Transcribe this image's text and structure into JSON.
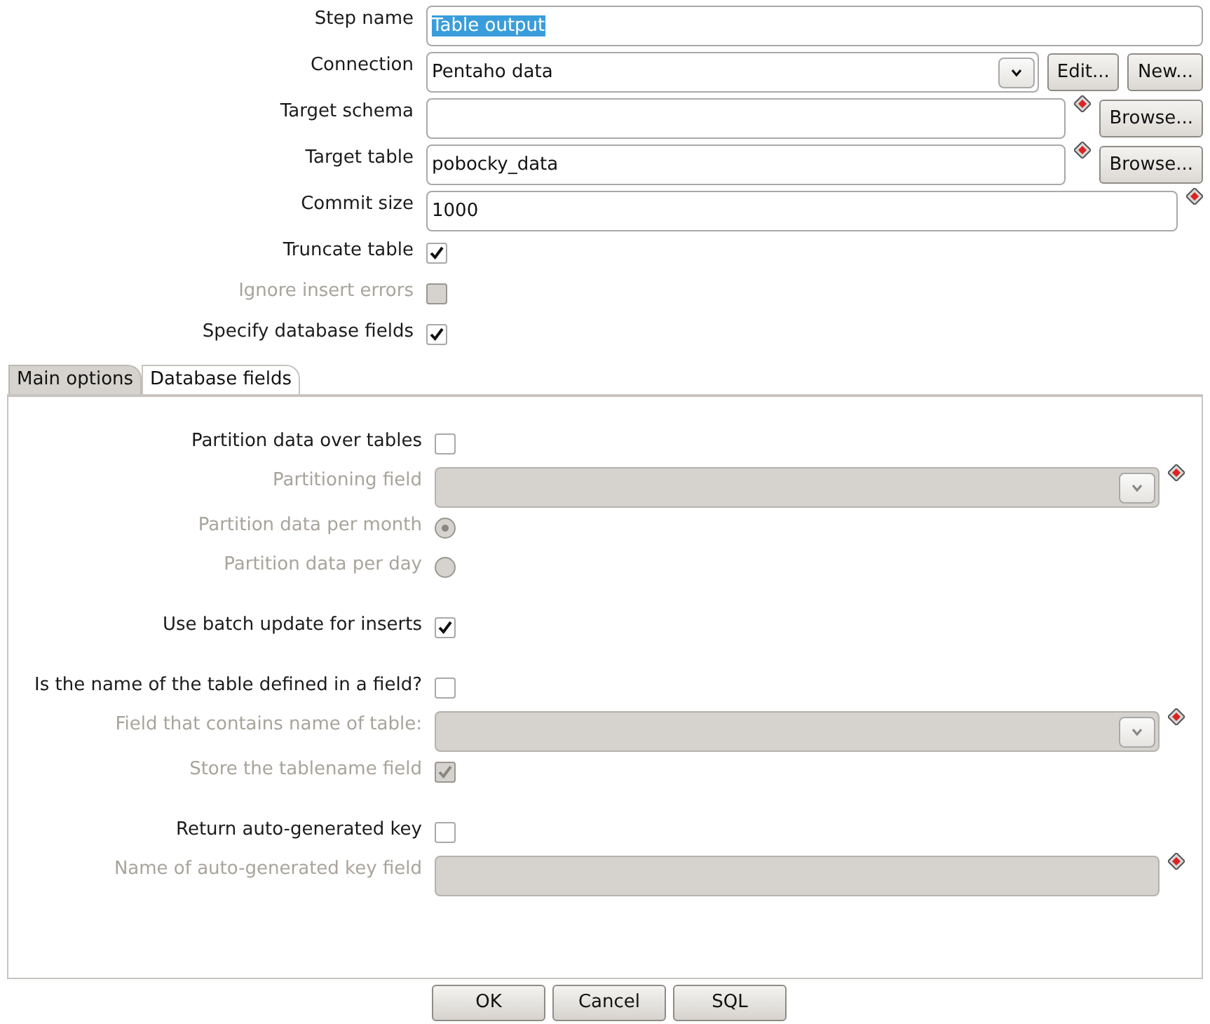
{
  "fields": [
    {
      "kind": "text",
      "label": "Step name",
      "value": "Table output",
      "value_selected": true,
      "disabled": false,
      "required": false
    },
    {
      "kind": "combo",
      "label": "Connection",
      "value": "Pentaho data",
      "disabled": false,
      "required": false,
      "buttons": [
        "Edit...",
        "New..."
      ]
    },
    {
      "kind": "text",
      "label": "Target schema",
      "disabled": false,
      "required": true,
      "buttons": [
        "Browse..."
      ]
    },
    {
      "kind": "text",
      "label": "Target table",
      "value": "pobocky_data",
      "disabled": false,
      "required": true,
      "buttons": [
        "Browse..."
      ]
    },
    {
      "kind": "text",
      "label": "Commit size",
      "value": "1000",
      "disabled": false,
      "required": true
    },
    {
      "kind": "checkbox",
      "label": "Truncate table",
      "checked": true,
      "disabled": false
    },
    {
      "kind": "checkbox",
      "label": "Ignore insert errors",
      "checked": false,
      "disabled": true
    },
    {
      "kind": "checkbox",
      "label": "Specify database fields",
      "checked": true,
      "disabled": false
    }
  ],
  "tabs": [
    {
      "label": "Main options",
      "selected": true
    },
    {
      "label": "Database fields",
      "selected": false
    }
  ],
  "panel_groups": [
    [
      {
        "kind": "checkbox",
        "label": "Partition data over tables",
        "checked": false,
        "disabled": false
      },
      {
        "kind": "combo",
        "label": "Partitioning field",
        "disabled": true,
        "required": true
      },
      {
        "kind": "radio",
        "label": "Partition data per month",
        "selected": true,
        "disabled": true
      },
      {
        "kind": "radio",
        "label": "Partition data per day",
        "selected": false,
        "disabled": true
      }
    ],
    [
      {
        "kind": "checkbox",
        "label": "Use batch update for inserts",
        "checked": true,
        "disabled": false
      }
    ],
    [
      {
        "kind": "checkbox",
        "label": "Is the name of the table defined in a field?",
        "checked": false,
        "disabled": false
      },
      {
        "kind": "combo",
        "label": "Field that contains name of table:",
        "disabled": true,
        "required": true
      },
      {
        "kind": "checkbox",
        "label": "Store the tablename field",
        "checked": true,
        "disabled": true
      }
    ],
    [
      {
        "kind": "checkbox",
        "label": "Return auto-generated key",
        "checked": false,
        "disabled": false
      },
      {
        "kind": "text",
        "label": "Name of auto-generated key field",
        "disabled": true,
        "required": true
      }
    ]
  ],
  "dialog_buttons": [
    "OK",
    "Cancel",
    "SQL"
  ]
}
